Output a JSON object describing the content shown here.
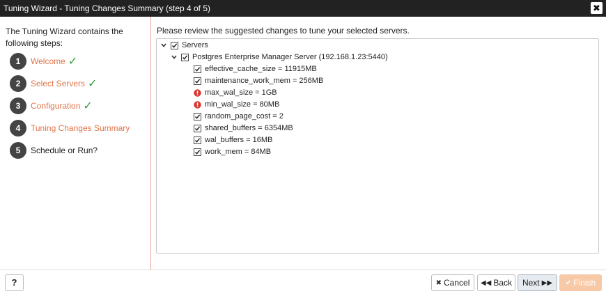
{
  "window": {
    "title": "Tuning Wizard - Tuning Changes Summary (step 4 of 5)",
    "close_glyph": "✖"
  },
  "sidebar": {
    "intro": "The Tuning Wizard contains the following steps:",
    "steps": [
      {
        "num": "1",
        "label": "Welcome",
        "done": true
      },
      {
        "num": "2",
        "label": "Select Servers",
        "done": true
      },
      {
        "num": "3",
        "label": "Configuration",
        "done": true
      },
      {
        "num": "4",
        "label": "Tuning Changes Summary",
        "done": false,
        "current": true
      },
      {
        "num": "5",
        "label": "Schedule or Run?",
        "done": false
      }
    ],
    "check_glyph": "✓"
  },
  "main": {
    "instruction": "Please review the suggested changes to tune your selected servers.",
    "tree": {
      "root": {
        "label": "Servers",
        "checked": true,
        "expanded": true
      },
      "server": {
        "label": "Postgres Enterprise Manager Server (192.168.1.23:5440)",
        "checked": true,
        "expanded": true
      },
      "params": [
        {
          "label": "effective_cache_size = 11915MB",
          "status": "checked"
        },
        {
          "label": "maintenance_work_mem = 256MB",
          "status": "checked"
        },
        {
          "label": "max_wal_size = 1GB",
          "status": "warning"
        },
        {
          "label": "min_wal_size = 80MB",
          "status": "warning"
        },
        {
          "label": "random_page_cost = 2",
          "status": "checked"
        },
        {
          "label": "shared_buffers = 6354MB",
          "status": "checked"
        },
        {
          "label": "wal_buffers = 16MB",
          "status": "checked"
        },
        {
          "label": "work_mem = 84MB",
          "status": "checked"
        }
      ]
    }
  },
  "footer": {
    "help_label": "?",
    "cancel_label": "Cancel",
    "back_label": "Back",
    "next_label": "Next",
    "finish_label": "Finish"
  },
  "colors": {
    "titlebar": "#222222",
    "step_done": "#e0744a",
    "check": "#2e9e3a",
    "warning": "#d9342b",
    "finish_button": "#f8c9a6"
  }
}
